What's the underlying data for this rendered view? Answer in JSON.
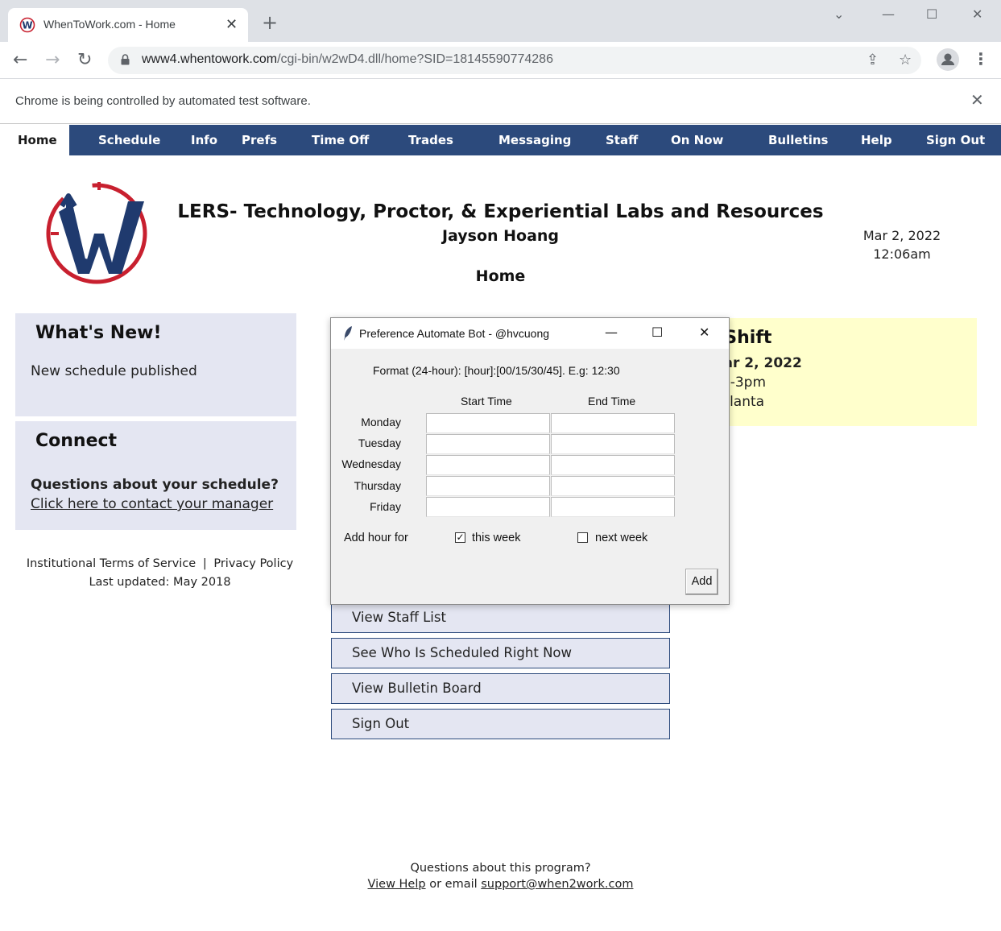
{
  "browser": {
    "tab_title": "WhenToWork.com - Home",
    "url_host": "www4.whentowork.com",
    "url_path": "/cgi-bin/w2wD4.dll/home?SID=18145590774286",
    "infobar_text": "Chrome is being controlled by automated test software."
  },
  "nav": {
    "items": [
      "Home",
      "Schedule",
      "Info",
      "Prefs",
      "Time Off",
      "Trades",
      "Messaging",
      "Staff",
      "On Now",
      "Bulletins",
      "Help",
      "Sign Out"
    ],
    "active": "Home"
  },
  "header": {
    "org_title": "LERS- Technology, Proctor, & Experiential Labs and Resources",
    "user_name": "Jayson Hoang",
    "page_heading": "Home",
    "date": "Mar 2, 2022",
    "time": "12:06am"
  },
  "whats_new": {
    "title": "What's New!",
    "text": "New schedule published"
  },
  "connect": {
    "title": "Connect",
    "question": "Questions about your schedule?",
    "link": "Click here to contact your manager"
  },
  "terms": {
    "tos": "Institutional Terms of Service",
    "separator": "|",
    "privacy": "Privacy Policy",
    "updated": "Last updated: May 2018"
  },
  "next_shift": {
    "title": "ext Shift",
    "date": "ed Mar 2, 2022",
    "time": ":30pm-3pm",
    "location": "Lab Atlanta"
  },
  "actions": [
    "View Staff List",
    "See Who Is Scheduled Right Now",
    "View Bulletin Board",
    "Sign Out"
  ],
  "footer": {
    "question": "Questions about this program?",
    "help_link": "View Help",
    "or_email": " or email ",
    "email": "support@when2work.com"
  },
  "dialog": {
    "title": "Preference Automate Bot - @hvcuong",
    "format": "Format (24-hour): [hour]:[00/15/30/45]. E.g: 12:30",
    "col_start": "Start Time",
    "col_end": "End Time",
    "days": [
      "Monday",
      "Tuesday",
      "Wednesday",
      "Thursday",
      "Friday"
    ],
    "add_hour_for": "Add hour for",
    "this_week": "this week",
    "this_week_checked": true,
    "next_week": "next week",
    "next_week_checked": false,
    "add_button": "Add"
  },
  "colors": {
    "nav_blue": "#2c4a7c",
    "panel_lavender": "#e4e6f2",
    "shift_yellow": "#ffffcc",
    "logo_red": "#c8202f"
  }
}
